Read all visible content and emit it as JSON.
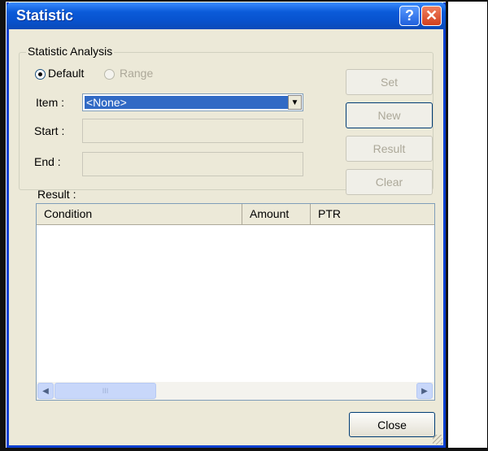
{
  "window": {
    "title": "Statistic"
  },
  "titlebar": {
    "help_label": "?",
    "close_label": "✕"
  },
  "group": {
    "title": "Statistic Analysis",
    "radio_default": "Default",
    "radio_range": "Range",
    "item_label": "Item  :",
    "item_value": "<None>",
    "start_label": "Start  :",
    "end_label": "End   :"
  },
  "buttons": {
    "set": "Set",
    "new": "New",
    "result": "Result",
    "clear": "Clear",
    "close": "Close"
  },
  "result": {
    "label": "Result :",
    "columns": [
      "Condition",
      "Amount",
      "PTR"
    ],
    "rows": []
  },
  "scrollbar": {
    "left_arrow": "◀",
    "right_arrow": "▶",
    "grip": "III"
  }
}
